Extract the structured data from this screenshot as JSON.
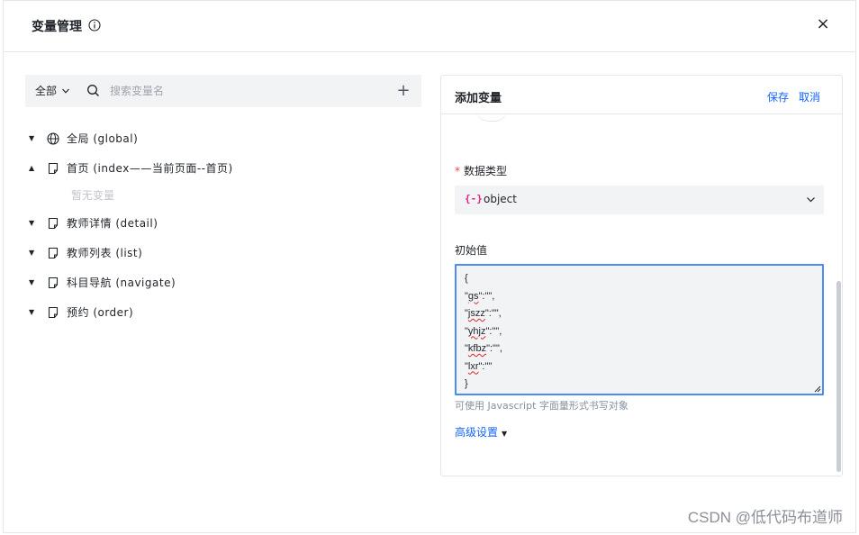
{
  "dialog": {
    "title": "变量管理",
    "close_label": "×"
  },
  "left": {
    "scope_label": "全部",
    "search_placeholder": "搜索变量名",
    "add_label": "+",
    "tree": [
      {
        "label": "全局 (global)",
        "icon": "globe-icon",
        "expanded": false
      },
      {
        "label": "首页 (index——当前页面--首页)",
        "icon": "page-icon",
        "expanded": true
      },
      {
        "label": "教师详情 (detail)",
        "icon": "page-icon",
        "expanded": false
      },
      {
        "label": "教师列表 (list)",
        "icon": "page-icon",
        "expanded": false
      },
      {
        "label": "科目导航 (navigate)",
        "icon": "page-icon",
        "expanded": false
      },
      {
        "label": "预约 (order)",
        "icon": "page-icon",
        "expanded": false
      }
    ],
    "empty_text": "暂无变量"
  },
  "right": {
    "title": "添加变量",
    "save_label": "保存",
    "cancel_label": "取消",
    "required_mark": "*",
    "type_label": "数据类型",
    "type_icon": "{-}",
    "type_value": "object",
    "init_label": "初始值",
    "code_lines": [
      "{",
      "\"gs\":\"\",",
      "\"jszz\":\"\",",
      "\"yhjz\":\"\",",
      "\"kfbz\":\"\",",
      "\"lxr\":\"\"",
      "}"
    ],
    "hint": "可使用 Javascript 字面量形式书写对象",
    "advanced_label": "高级设置",
    "advanced_caret": "▼"
  },
  "watermark": "CSDN @低代码布道师",
  "colors": {
    "accent": "#1664ff",
    "type_icon": "#e0218a",
    "required": "#f53f3f",
    "input_bg": "#f2f3f5",
    "focus_border": "#4c8bf5"
  }
}
